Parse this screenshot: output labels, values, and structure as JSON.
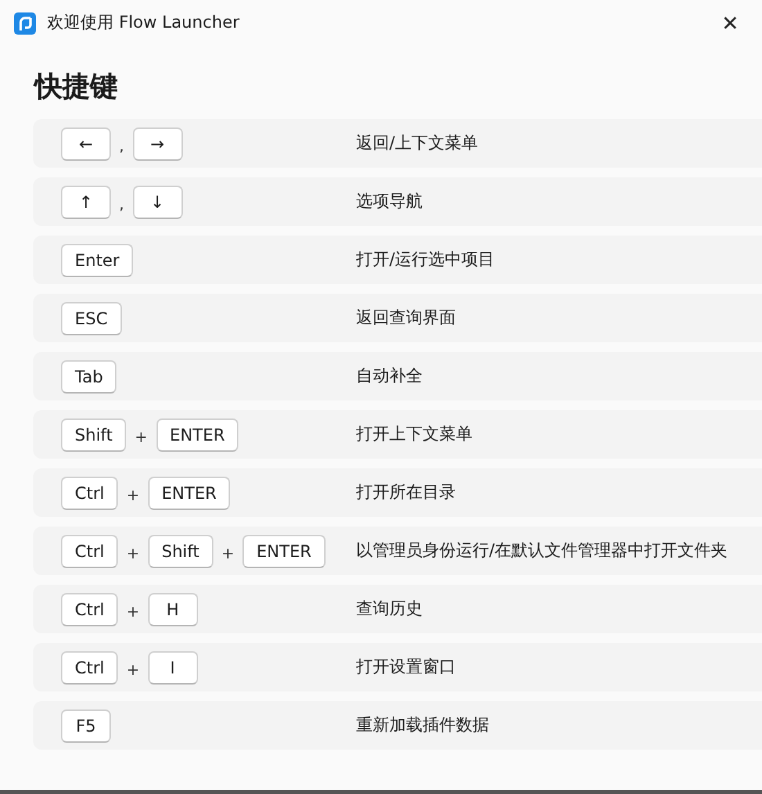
{
  "window": {
    "title": "欢迎使用 Flow Launcher",
    "close": "✕"
  },
  "heading": "快捷键",
  "shortcuts": [
    {
      "keys": [
        "←",
        "→"
      ],
      "joiner": ",",
      "description": "返回/上下文菜单"
    },
    {
      "keys": [
        "↑",
        "↓"
      ],
      "joiner": ",",
      "description": "选项导航"
    },
    {
      "keys": [
        "Enter"
      ],
      "description": "打开/运行选中项目"
    },
    {
      "keys": [
        "ESC"
      ],
      "description": "返回查询界面"
    },
    {
      "keys": [
        "Tab"
      ],
      "description": "自动补全"
    },
    {
      "keys": [
        "Shift",
        "ENTER"
      ],
      "joiner": "+",
      "description": "打开上下文菜单"
    },
    {
      "keys": [
        "Ctrl",
        "ENTER"
      ],
      "joiner": "+",
      "description": "打开所在目录"
    },
    {
      "keys": [
        "Ctrl",
        "Shift",
        "ENTER"
      ],
      "joiner": "+",
      "description": "以管理员身份运行/在默认文件管理器中打开文件夹"
    },
    {
      "keys": [
        "Ctrl",
        "H"
      ],
      "joiner": "+",
      "description": "查询历史"
    },
    {
      "keys": [
        "Ctrl",
        "I"
      ],
      "joiner": "+",
      "description": "打开设置窗口"
    },
    {
      "keys": [
        "F5"
      ],
      "description": "重新加载插件数据"
    }
  ]
}
